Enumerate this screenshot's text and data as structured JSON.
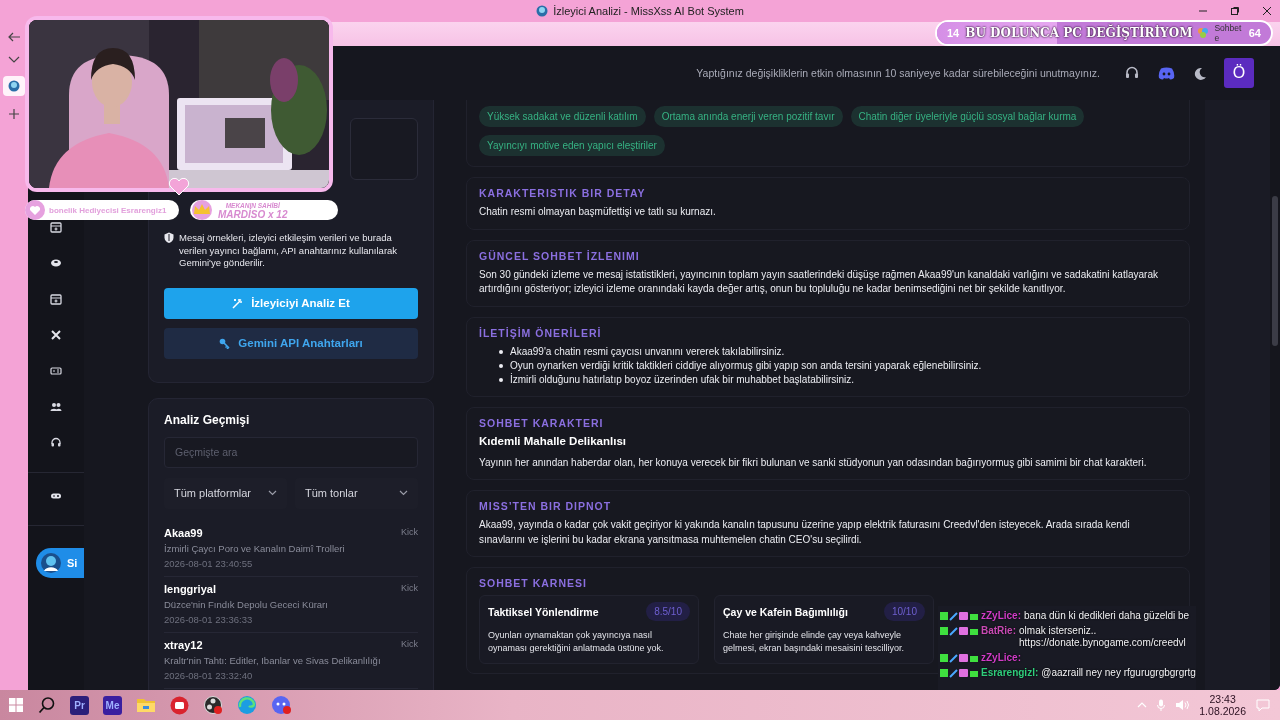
{
  "window": {
    "title": "İzleyici Analizi - MissXss AI Bot System"
  },
  "browser_bar": {
    "chat_label": "Sohbet e"
  },
  "header": {
    "notice": "Yaptığınız değişikliklerin etkin olmasının 10 saniyeye kadar sürebileceğini unutmayınız.",
    "avatar": "Ö"
  },
  "nav": {
    "user_label": "Si"
  },
  "analyze_panel": {
    "privacy_note": "Mesaj örnekleri, izleyici etkileşim verileri ve burada verilen yayıncı bağlamı, API anahtarınız kullanılarak Gemini'ye gönderilir.",
    "buttons": [
      {
        "label": "İzleyiciyi Analiz Et",
        "kind": "primary"
      },
      {
        "label": "Gemini API Anahtarları",
        "kind": "secondary"
      }
    ]
  },
  "history": {
    "title": "Analiz Geçmişi",
    "search": {
      "placeholder": "Geçmişte ara"
    },
    "filters": [
      {
        "label": "Tüm platformlar"
      },
      {
        "label": "Tüm tonlar"
      }
    ],
    "entries": [
      {
        "name": "Akaa99",
        "title": "İzmirli Çaycı Poro ve Kanalın Daimî Trolleri",
        "time": "2026-08-01 23:40:55",
        "platform": "Kick"
      },
      {
        "name": "lenggriyal",
        "title": "Düzce'nin Fındık Depolu Gececi Kürarı",
        "time": "2026-08-01 23:36:33",
        "platform": "Kick"
      },
      {
        "name": "xtray12",
        "title": "Kraltr'nin Tahtı: Editler, Ibanlar ve Sivas Delikanlılığı",
        "time": "2026-08-01 23:32:40",
        "platform": "Kick"
      }
    ]
  },
  "analysis": {
    "tags": [
      "Yüksek sadakat ve düzenli katılım",
      "Ortama anında enerji veren pozitif tavır",
      "Chatin diğer üyeleriyle güçlü sosyal bağlar kurma",
      "Yayıncıyı motive eden yapıcı eleştiriler"
    ],
    "sections": [
      {
        "kind": "text",
        "heading": "KARAKTERISTIK BIR DETAY",
        "body": "Chatin resmi olmayan başmüfettişi ve tatlı su kurnazı."
      },
      {
        "kind": "text",
        "heading": "GÜNCEL SOHBET İZLENIMI",
        "body": "Son 30 gündeki izleme ve mesaj istatistikleri, yayıncının toplam yayın saatlerindeki düşüşe rağmen Akaa99'un kanaldaki varlığını ve sadakatini katlayarak artırdığını gösteriyor; izleyici izleme oranındaki kayda değer artış, onun bu topluluğu ne kadar benimsediğini net bir şekilde kanıtlıyor."
      },
      {
        "kind": "list",
        "heading": "İLETİŞİM ÖNERİLERİ",
        "items": [
          "Akaa99'a chatin resmi çaycısı unvanını vererek takılabilirsiniz.",
          "Oyun oynarken verdiği kritik taktikleri ciddiye alıyormuş gibi yapıp son anda tersini yaparak eğlenebilirsiniz.",
          "İzmirli olduğunu hatırlatıp boyoz üzerinden ufak bir muhabbet başlatabilirsiniz."
        ]
      },
      {
        "kind": "character",
        "heading": "SOHBET KARAKTERI",
        "subtitle": "Kıdemli Mahalle Delikanlısı",
        "body": "Yayının her anından haberdar olan, her konuya verecek bir fikri bulunan ve sanki stüdyonun yan odasından bağırıyormuş gibi samimi bir chat karakteri."
      },
      {
        "kind": "text",
        "heading": "MISS’TEN BIR DIPNOT",
        "body": "Akaa99, yayında o kadar çok vakit geçiriyor ki yakında kanalın tapusunu üzerine yapıp elektrik faturasını Creedvl'den isteyecek. Arada sırada kendi sınavlarını ve işlerini bu kadar ekrana yansıtmasa muhtemelen chatin CEO'su seçilirdi."
      }
    ],
    "scorecard": {
      "heading": "SOHBET KARNESI",
      "cards": [
        {
          "title": "Taktiksel Yönlendirme",
          "score": "8.5/10",
          "body": "Oyunları oynamaktan çok yayıncıya nasıl oynaması gerektiğini anlatmada üstüne yok."
        },
        {
          "title": "Çay ve Kafein Bağımlılığı",
          "score": "10/10",
          "body": "Chate her girişinde elinde çay veya kahveyle gelmesi, ekran başındaki mesaisini tescilliyor."
        }
      ]
    }
  },
  "taskbar": {
    "apps": [
      {
        "kind": "start"
      },
      {
        "kind": "search"
      },
      {
        "kind": "letters",
        "label": "Pr",
        "color": "#2b1f7a"
      },
      {
        "kind": "letters",
        "label": "Me",
        "color": "#3a1fa0"
      },
      {
        "kind": "folder"
      },
      {
        "kind": "red-app"
      },
      {
        "kind": "record"
      },
      {
        "kind": "browser"
      },
      {
        "kind": "chat-app"
      }
    ],
    "time": "23:43",
    "date": "1.08.2026"
  },
  "stream_overlay": {
    "goal": {
      "current": "14",
      "label": "BU DOLUNCA PC DEĞİŞTİRİYOM",
      "target": "64",
      "level": 0.36
    },
    "badges": [
      {
        "kind": "heart",
        "label": "bonelik Hediyecisi Esrarengiz1"
      },
      {
        "kind": "crown",
        "top": "MEKANIN SAHİBİ",
        "label": "MARDİSO x 12"
      }
    ],
    "chat": [
      {
        "user": "zZyLice:",
        "color": "#d23cc8",
        "message": "bana dün ki dedikleri daha güzeldi be"
      },
      {
        "user": "BatRie:",
        "color": "#c84ab4",
        "message": "olmak isterseniz.. https://donate.bynogame.com/creedvl"
      },
      {
        "user": "zZyLice:",
        "color": "#d23cc8"
      },
      {
        "user": "Esrarengizl:",
        "color": "#2fce7c",
        "message": "@aazraill ney ney rfgurugrgbgrgrtg"
      }
    ]
  }
}
